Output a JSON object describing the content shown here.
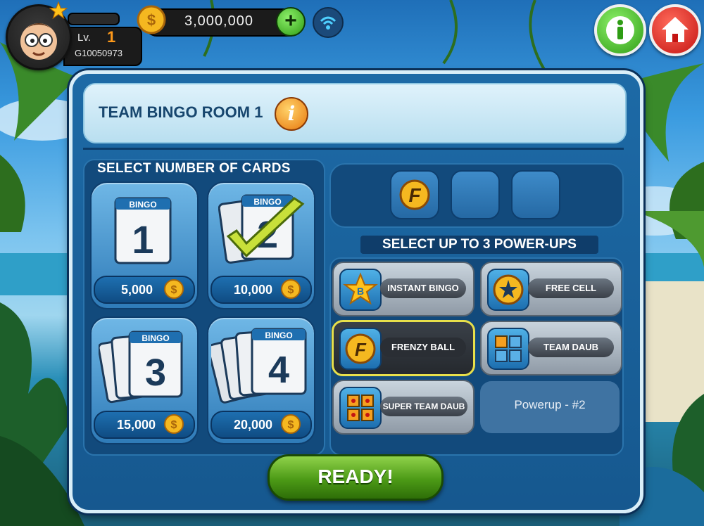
{
  "player": {
    "level_label": "Lv.",
    "level": "1",
    "player_id": "G10050973"
  },
  "currency": {
    "coins": "3,000,000"
  },
  "room": {
    "title": "TEAM BINGO ROOM 1"
  },
  "cards": {
    "section_title": "SELECT NUMBER OF CARDS",
    "options": [
      {
        "count": "1",
        "price": "5,000",
        "selected": false
      },
      {
        "count": "2",
        "price": "10,000",
        "selected": true
      },
      {
        "count": "3",
        "price": "15,000",
        "selected": false
      },
      {
        "count": "4",
        "price": "20,000",
        "selected": false
      }
    ],
    "card_header": "BINGO"
  },
  "powerups": {
    "section_title": "SELECT UP TO 3 POWER-UPS",
    "items": [
      {
        "label": "INSTANT BINGO",
        "selected": false
      },
      {
        "label": "FREE CELL",
        "selected": false
      },
      {
        "label": "FRENZY BALL",
        "selected": true
      },
      {
        "label": "TEAM DAUB",
        "selected": false
      },
      {
        "label": "SUPER TEAM DAUB",
        "selected": false
      }
    ],
    "placeholder": "Powerup - #2"
  },
  "ready_label": "READY!",
  "colors": {
    "panel": "#1d6aa6",
    "accent_green": "#4c9a16",
    "coin_gold": "#f5b820",
    "selection_yellow": "#e8e04a"
  }
}
